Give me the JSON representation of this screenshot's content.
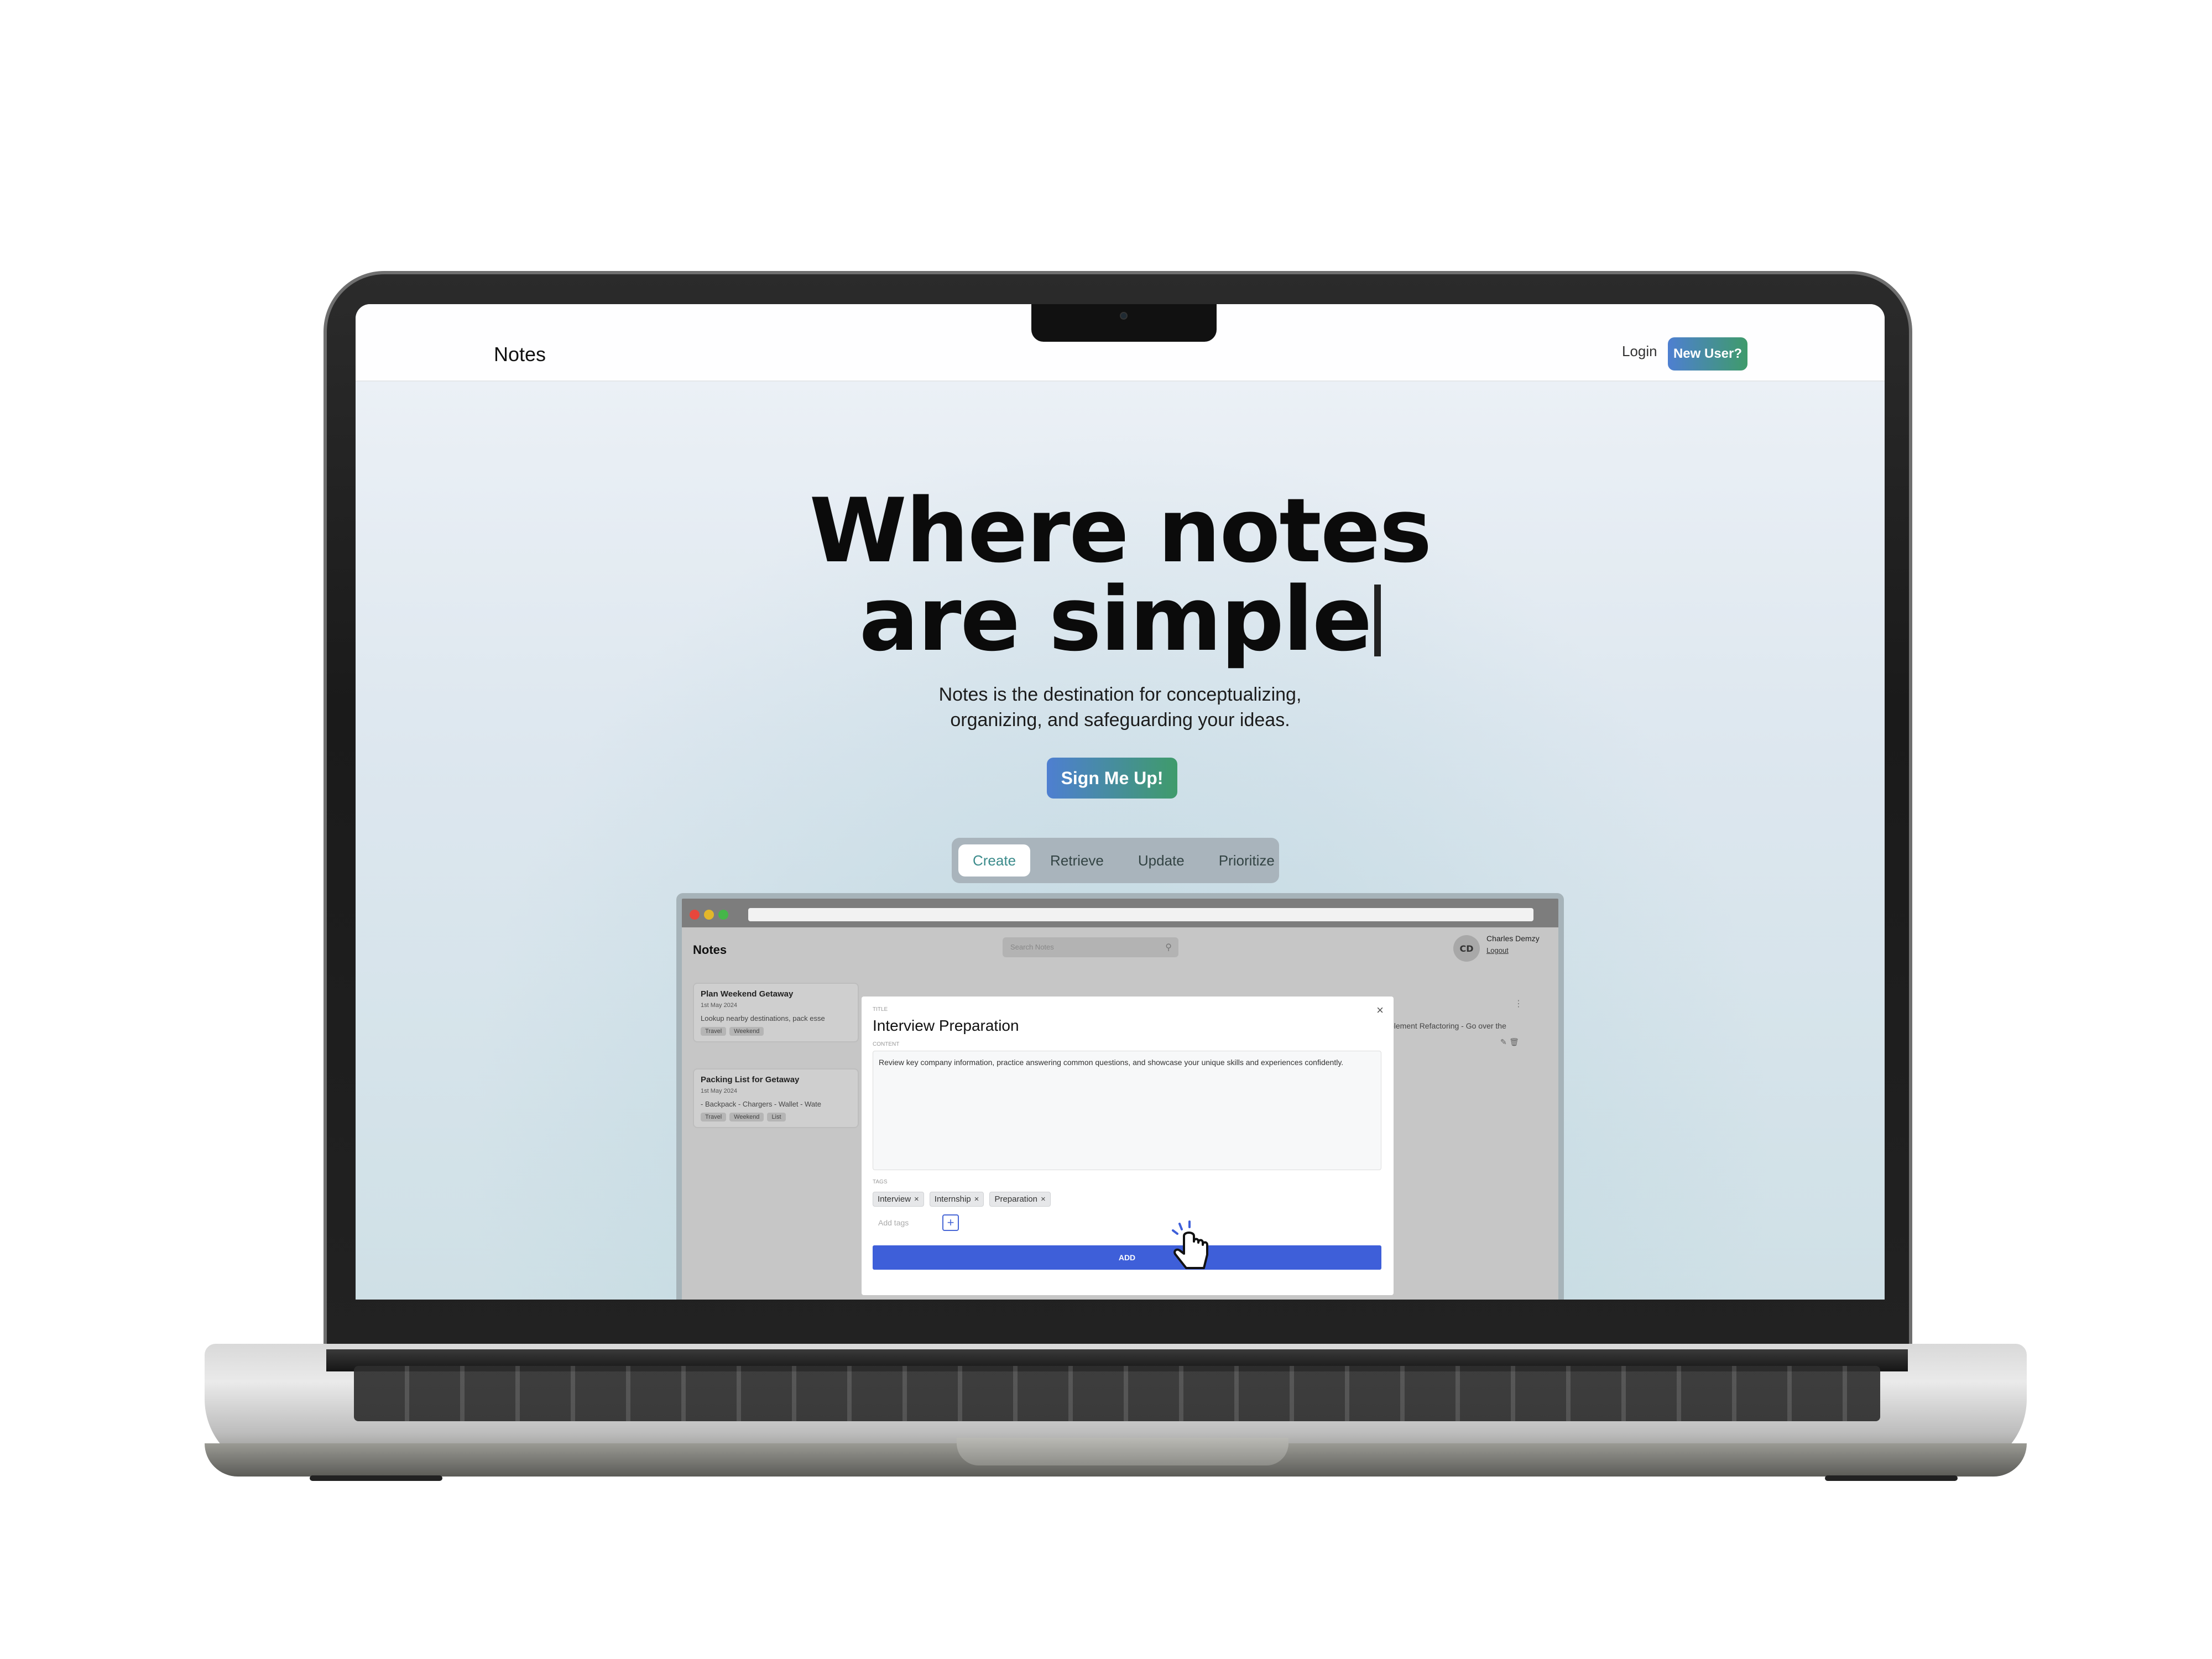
{
  "nav": {
    "brand": "Notes",
    "login": "Login",
    "new_user": "New User?"
  },
  "hero": {
    "title_line1": "Where notes",
    "title_line2": "are simple",
    "subtitle_line1": "Notes is the destination for conceptualizing,",
    "subtitle_line2": "organizing, and safeguarding your ideas.",
    "cta": "Sign Me Up!"
  },
  "tabs": [
    {
      "label": "Create",
      "active": true
    },
    {
      "label": "Retrieve",
      "active": false
    },
    {
      "label": "Update",
      "active": false
    },
    {
      "label": "Prioritize",
      "active": false
    }
  ],
  "preview": {
    "brand": "Notes",
    "search_placeholder": "Search Notes",
    "avatar_initials": "CD",
    "user_name": "Charles Demzy",
    "logout": "Logout",
    "cards": [
      {
        "title": "Plan Weekend Getaway",
        "date": "1st May 2024",
        "text": "Lookup nearby destinations, pack esse",
        "tags": [
          "Travel",
          "Weekend"
        ]
      },
      {
        "title": "Packing List for Getaway",
        "date": "1st May 2024",
        "text": "- Backpack - Chargers - Wallet - Wate",
        "tags": [
          "Travel",
          "Weekend",
          "List"
        ]
      }
    ],
    "right_card_text": "plement Refactoring - Go over the",
    "modal": {
      "title_label": "Title",
      "title": "Interview Preparation",
      "content_label": "Content",
      "content": "Review key company information, practice answering common questions, and showcase your unique skills and experiences confidently.",
      "tags_label": "Tags",
      "tags": [
        "Interview",
        "Internship",
        "Preparation"
      ],
      "add_tags_placeholder": "Add tags",
      "add_button": "ADD"
    }
  },
  "colors": {
    "accent_gradient_start": "#4e7fd1",
    "accent_gradient_end": "#3f9b6b",
    "add_button": "#3e5fd9"
  }
}
